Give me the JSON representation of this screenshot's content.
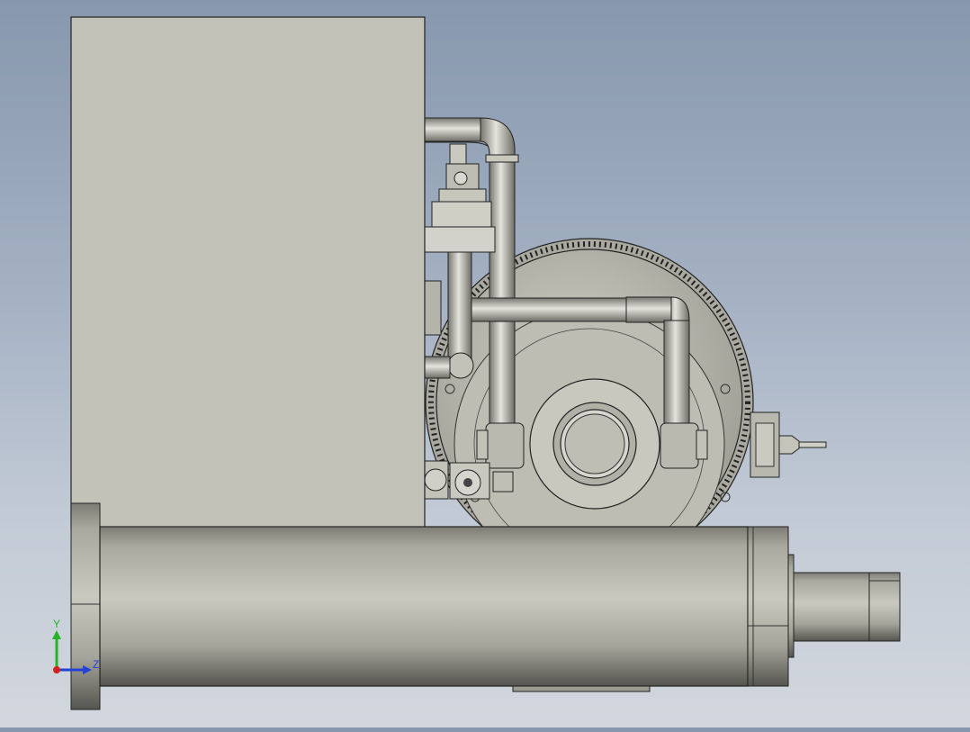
{
  "view": {
    "type": "cad-orthographic-side-view",
    "background_top": "#8797ad",
    "background_bottom": "#d2d7de",
    "part_color": "#c2c2b8",
    "edge_color": "#222222"
  },
  "triad": {
    "y_label": "Y",
    "z_label": "Z",
    "y_color": "#27b327",
    "z_color": "#2340d8",
    "x_color": "#d42020"
  }
}
